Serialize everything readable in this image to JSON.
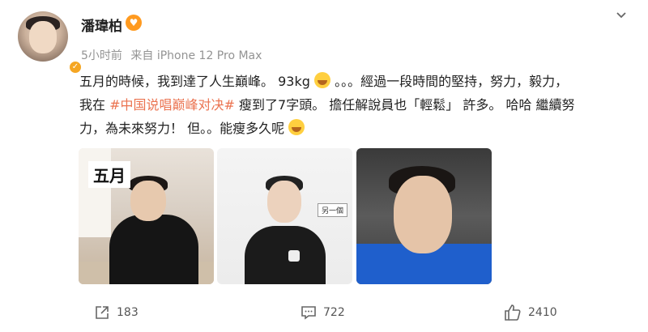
{
  "post": {
    "username": "潘瑋柏",
    "meta": {
      "time": "5小时前",
      "source": "来自 iPhone 12 Pro Max"
    },
    "text": {
      "line1_a": "五月的時候，我到達了人生巔峰。 93kg",
      "line1_b": "。。。經過一段時間的堅持，努力，毅力，",
      "line2_a": "我在 ",
      "hashtag": "#中国说唱巅峰对决#",
      "line2_b": " 瘦到了7字頭。 擔任解說員也「輕鬆」 許多。 哈哈 繼續努",
      "line3": "力，為未來努力！ 但。。能瘦多久呢"
    },
    "photos": {
      "photo1_label": "五月",
      "photo2_caption": "另一個"
    },
    "actions": {
      "share_count": "183",
      "comment_count": "722",
      "like_count": "2410"
    }
  },
  "icons": {
    "share": "share-icon",
    "comment": "comment-icon",
    "like": "thumbs-up-icon",
    "chevron": "chevron-down-icon",
    "vip": "vip-heart-icon"
  },
  "colors": {
    "hashtag": "#eb7350",
    "meta_text": "#939393",
    "jacket_blue": "#1f5fcc"
  }
}
